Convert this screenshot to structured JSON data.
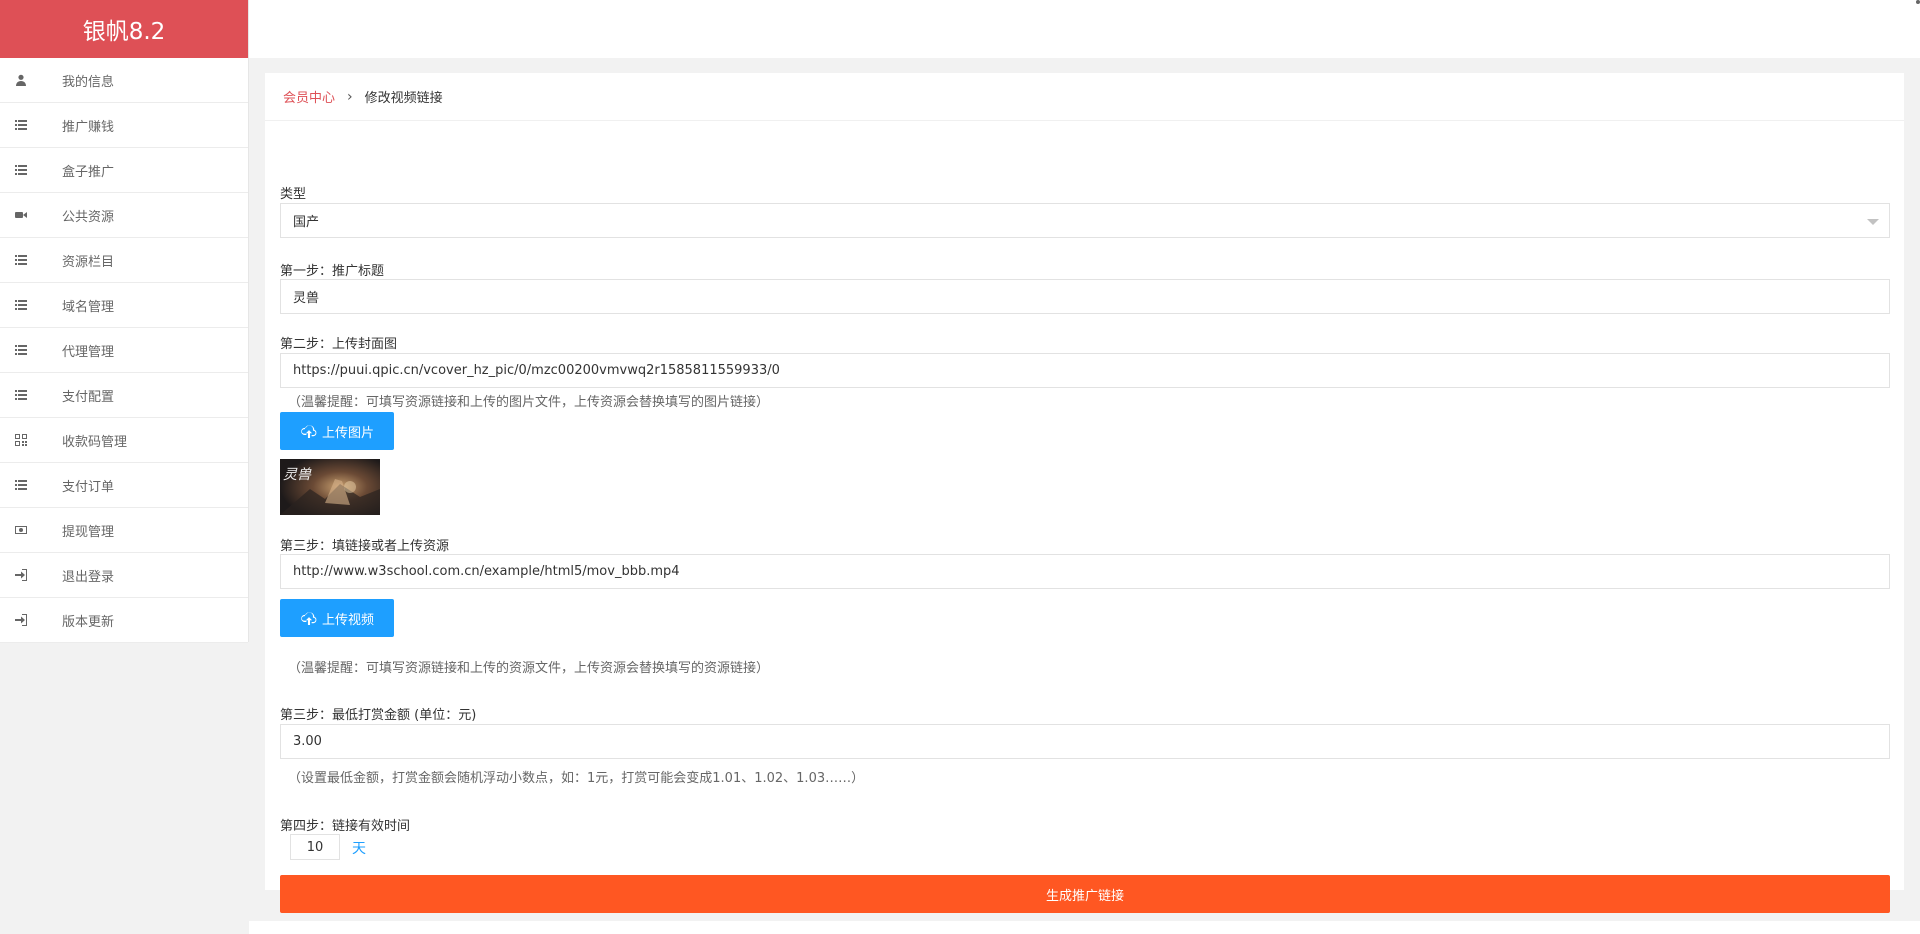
{
  "brand": {
    "title": "银帆8.2"
  },
  "sidebar": {
    "items": [
      {
        "label": "我的信息",
        "icon": "user-icon"
      },
      {
        "label": "推广赚钱",
        "icon": "list-icon"
      },
      {
        "label": "盒子推广",
        "icon": "list-icon"
      },
      {
        "label": "公共资源",
        "icon": "video-camera-icon"
      },
      {
        "label": "资源栏目",
        "icon": "list-icon"
      },
      {
        "label": "域名管理",
        "icon": "list-icon"
      },
      {
        "label": "代理管理",
        "icon": "list-icon"
      },
      {
        "label": "支付配置",
        "icon": "list-icon"
      },
      {
        "label": "收款码管理",
        "icon": "qrcode-icon"
      },
      {
        "label": "支付订单",
        "icon": "list-icon"
      },
      {
        "label": "提现管理",
        "icon": "money-icon"
      },
      {
        "label": "退出登录",
        "icon": "sign-in-icon"
      },
      {
        "label": "版本更新",
        "icon": "sign-in-icon"
      }
    ]
  },
  "breadcrumb": {
    "link": "会员中心",
    "separator": "›",
    "current": "修改视频链接"
  },
  "form": {
    "type_label": "类型",
    "type_value": "国产",
    "step1_label": "第一步：推广标题",
    "step1_value": "灵兽",
    "step2_label": "第二步：上传封面图",
    "step2_value": "https://puui.qpic.cn/vcover_hz_pic/0/mzc00200vmvwq2r1585811559933/0",
    "step2_hint": "（温馨提醒：可填写资源链接和上传的图片文件，上传资源会替换填写的图片链接）",
    "upload_image_label": "上传图片",
    "cover_text": "灵兽",
    "step3_label": "第三步：填链接或者上传资源",
    "step3_value": "http://www.w3school.com.cn/example/html5/mov_bbb.mp4",
    "upload_video_label": "上传视频",
    "step3_hint": "（温馨提醒：可填写资源链接和上传的资源文件，上传资源会替换填写的资源链接）",
    "amount_label": "第三步：最低打赏金额 (单位：元)",
    "amount_value": "3.00",
    "amount_hint": "（设置最低金额，打赏金额会随机浮动小数点，如：1元，打赏可能会变成1.01、1.02、1.03……）",
    "step4_label": "第四步：链接有效时间",
    "days_value": "10",
    "days_unit": "天",
    "submit_label": "生成推广链接"
  },
  "colors": {
    "brand": "#de5056",
    "primary": "#1e9fff",
    "submit": "#ff5722"
  }
}
